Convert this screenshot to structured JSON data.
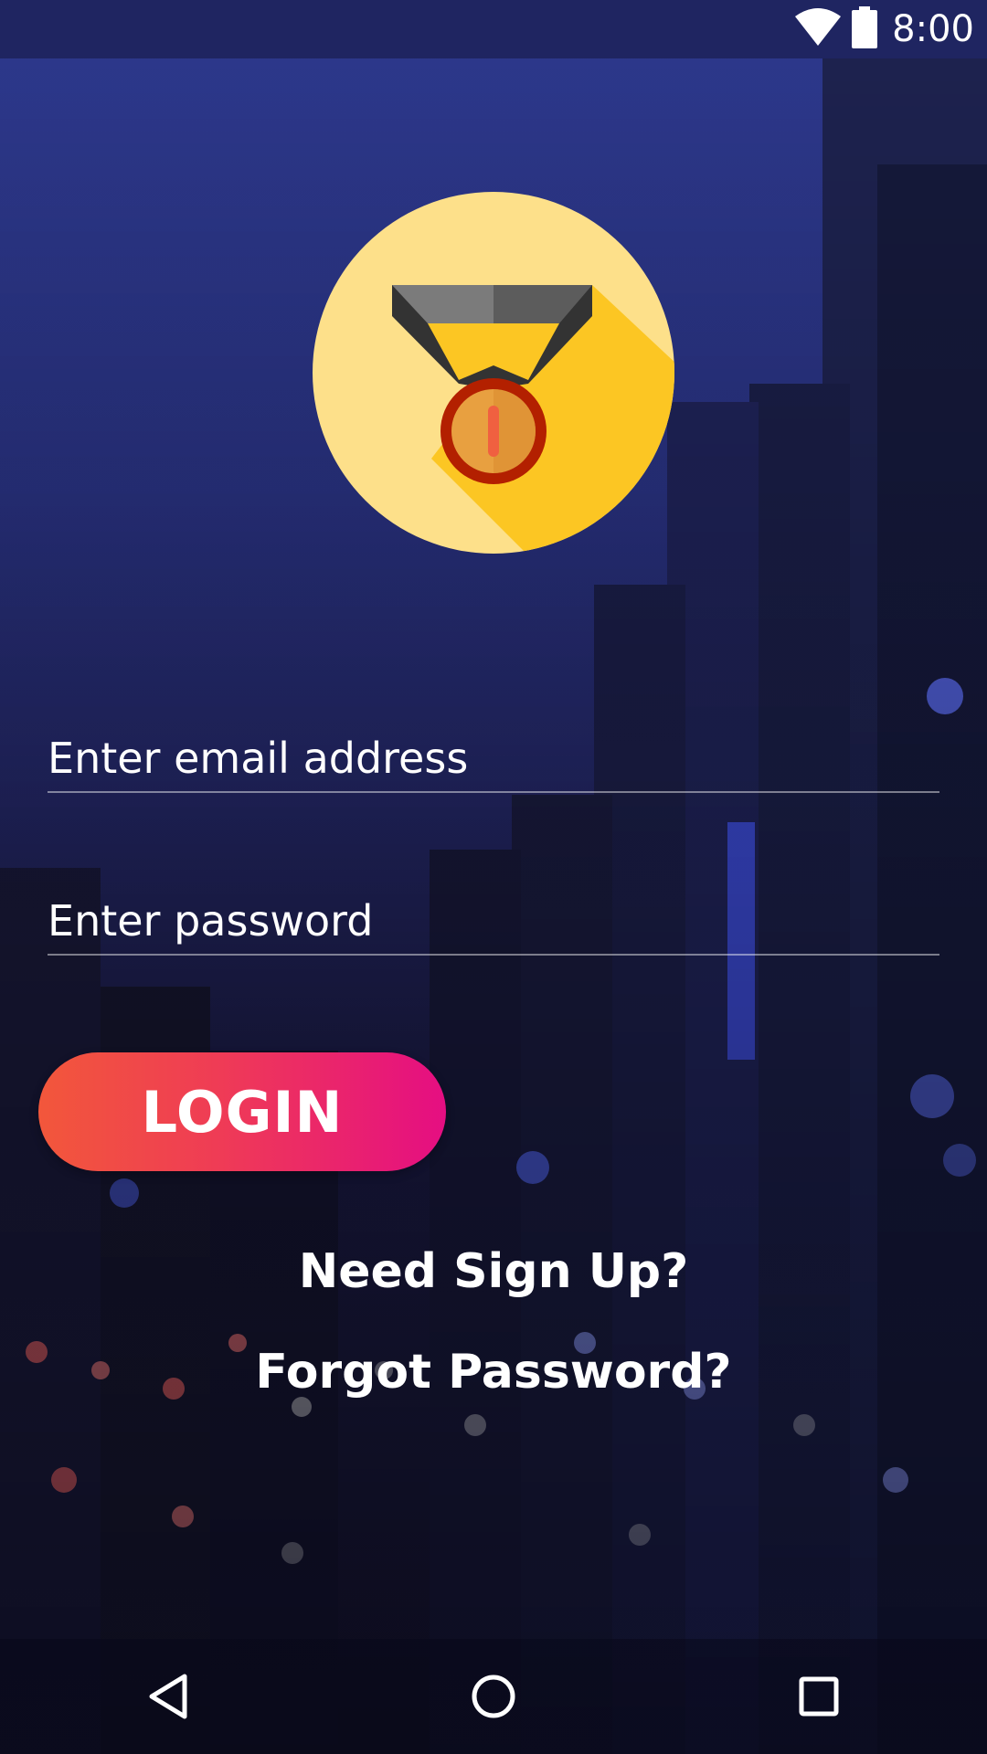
{
  "status_bar": {
    "time": "8:00",
    "icons": [
      "wifi-icon",
      "battery-icon"
    ]
  },
  "logo": {
    "icon": "medal-icon",
    "colors": {
      "circle": "#fde08a",
      "shadow": "#fcc623",
      "ribbon_light": "#7b7b7b",
      "ribbon_dark": "#333333",
      "medal_ring": "#b32000",
      "medal_face": "#e8a040",
      "medal_stripe": "#f06040"
    }
  },
  "form": {
    "email_placeholder": "Enter email address",
    "email_value": "",
    "password_placeholder": "Enter password",
    "password_value": ""
  },
  "login_button": {
    "label": "LOGIN",
    "gradient": [
      "#f2573b",
      "#e50e82"
    ]
  },
  "links": {
    "signup": "Need Sign Up?",
    "forgot_password": "Forgot Password?"
  },
  "nav_bar": {
    "icons": [
      "back-icon",
      "home-icon",
      "recents-icon"
    ]
  }
}
